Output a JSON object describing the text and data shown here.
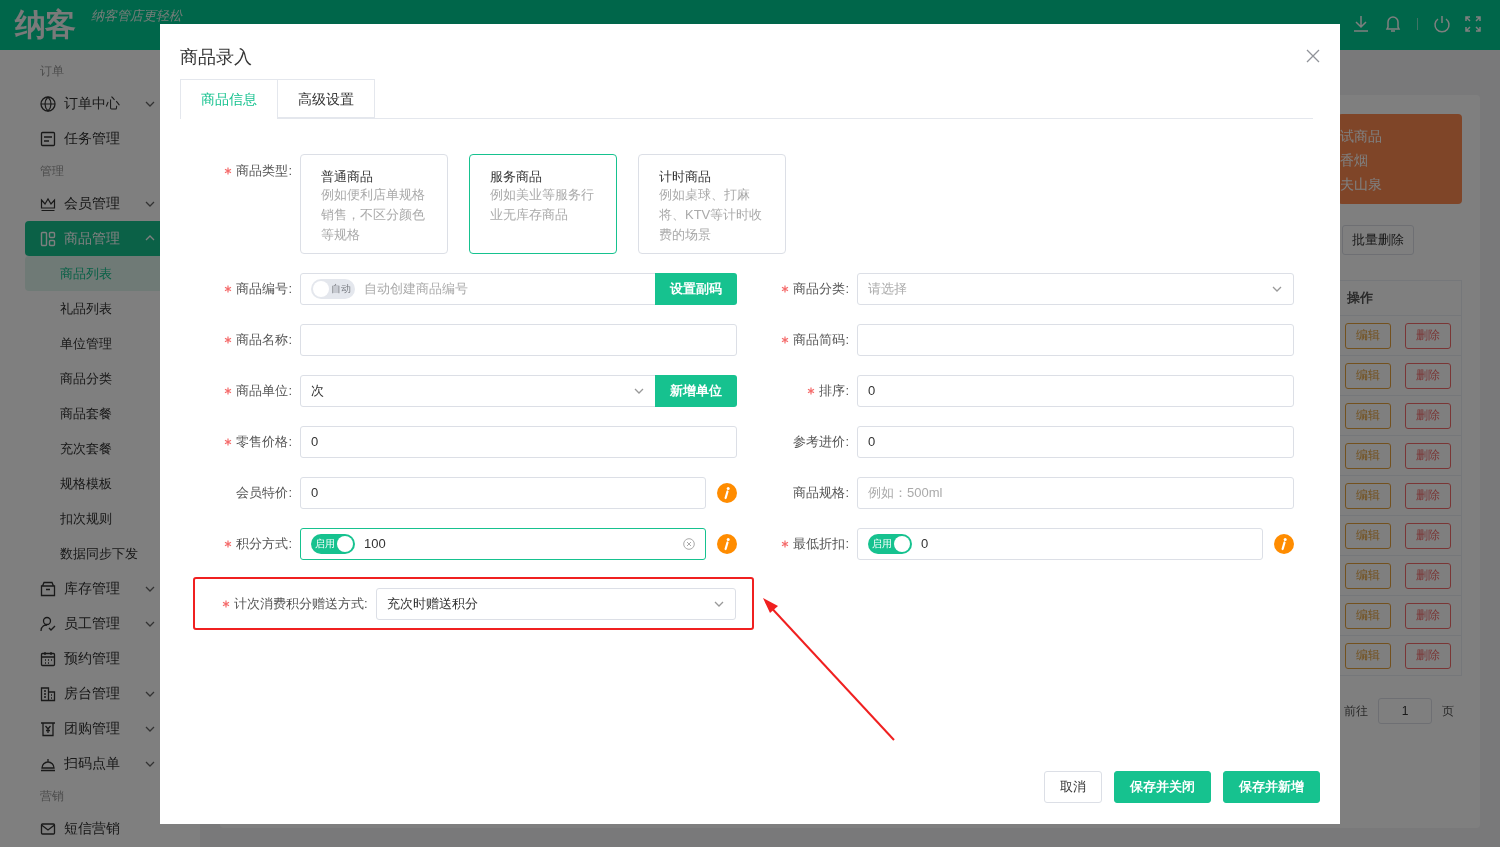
{
  "header": {
    "logo": "纳客",
    "slogan": "纳客管店更轻松"
  },
  "sidebar": {
    "sections": [
      {
        "title": "订单",
        "items": [
          {
            "label": "订单中心",
            "expanded": false,
            "selected": false
          },
          {
            "label": "任务管理",
            "selected": false
          }
        ]
      },
      {
        "title": "管理",
        "items": [
          {
            "label": "会员管理",
            "expanded": false,
            "selected": false
          },
          {
            "label": "商品管理",
            "expanded": true,
            "selected": true,
            "children": [
              {
                "label": "商品列表",
                "selected": true
              },
              {
                "label": "礼品列表",
                "selected": false
              },
              {
                "label": "单位管理",
                "selected": false
              },
              {
                "label": "商品分类",
                "selected": false
              },
              {
                "label": "商品套餐",
                "selected": false
              },
              {
                "label": "充次套餐",
                "selected": false
              },
              {
                "label": "规格模板",
                "selected": false
              },
              {
                "label": "扣次规则",
                "selected": false
              },
              {
                "label": "数据同步下发",
                "selected": false
              }
            ]
          },
          {
            "label": "库存管理",
            "expanded": false,
            "selected": false
          },
          {
            "label": "员工管理",
            "expanded": false,
            "selected": false
          },
          {
            "label": "预约管理",
            "selected": false
          },
          {
            "label": "房台管理",
            "expanded": false,
            "selected": false
          },
          {
            "label": "团购管理",
            "expanded": false,
            "selected": false
          },
          {
            "label": "扫码点单",
            "expanded": false,
            "selected": false
          }
        ]
      },
      {
        "title": "营销",
        "items": [
          {
            "label": "短信营销",
            "selected": false
          }
        ]
      }
    ]
  },
  "background": {
    "banner_lines": [
      "试商品",
      "香烟",
      "夫山泉"
    ],
    "batch_button": "批量删除",
    "table": {
      "column": "操作",
      "rows": [
        {
          "edit": "编辑",
          "delete": "删除"
        },
        {
          "edit": "编辑",
          "delete": "删除"
        },
        {
          "edit": "编辑",
          "delete": "删除"
        },
        {
          "edit": "编辑",
          "delete": "删除"
        },
        {
          "edit": "编辑",
          "delete": "删除"
        },
        {
          "edit": "编辑",
          "delete": "删除"
        },
        {
          "edit": "编辑",
          "delete": "删除"
        },
        {
          "edit": "编辑",
          "delete": "删除"
        },
        {
          "edit": "编辑",
          "delete": "删除"
        }
      ]
    },
    "pagination": {
      "goto": "前往",
      "page": "1",
      "suffix": "页"
    }
  },
  "dialog": {
    "title": "商品录入",
    "tabs": [
      {
        "label": "商品信息",
        "selected": true
      },
      {
        "label": "高级设置",
        "selected": false
      }
    ],
    "type_field": {
      "label": "商品类型:",
      "required": true,
      "options": [
        {
          "title": "普通商品",
          "description": "例如便利店单规格销售，不区分颜色等规格",
          "selected": false
        },
        {
          "title": "服务商品",
          "description": "例如美业等服务行业无库存商品",
          "selected": true
        },
        {
          "title": "计时商品",
          "description": "例如桌球、打麻将、KTV等计时收费的场景",
          "selected": false
        }
      ]
    },
    "rows": [
      {
        "left": {
          "label": "商品编号:",
          "required": true,
          "kind": "toggle-input",
          "toggle": {
            "label": "自动",
            "on": false
          },
          "placeholder": "自动创建商品编号",
          "button": "设置副码"
        },
        "right": {
          "label": "商品分类:",
          "required": true,
          "kind": "select",
          "placeholder": "请选择"
        }
      },
      {
        "left": {
          "label": "商品名称:",
          "required": true,
          "kind": "input"
        },
        "right": {
          "label": "商品简码:",
          "required": true,
          "kind": "input"
        }
      },
      {
        "left": {
          "label": "商品单位:",
          "required": true,
          "kind": "select",
          "value": "次",
          "button": "新增单位"
        },
        "right": {
          "label": "排序:",
          "required": true,
          "kind": "input",
          "value": "0"
        }
      },
      {
        "left": {
          "label": "零售价格:",
          "required": true,
          "kind": "input",
          "value": "0"
        },
        "right": {
          "label": "参考进价:",
          "kind": "input",
          "value": "0"
        }
      },
      {
        "left": {
          "label": "会员特价:",
          "kind": "input",
          "value": "0",
          "info": true
        },
        "right": {
          "label": "商品规格:",
          "kind": "input",
          "placeholder": "例如：500ml"
        }
      },
      {
        "left": {
          "label": "积分方式:",
          "required": true,
          "kind": "toggle-input",
          "toggle": {
            "label": "启用",
            "on": true
          },
          "value": "100",
          "info": true,
          "focused": true,
          "clearable": true
        },
        "right": {
          "label": "最低折扣:",
          "required": true,
          "kind": "toggle-input",
          "toggle": {
            "label": "启用",
            "on": true
          },
          "value": "0",
          "info": true
        }
      }
    ],
    "highlighted_field": {
      "label": "计次消费积分赠送方式:",
      "required": true,
      "kind": "select",
      "value": "充次时赠送积分",
      "pointer_arrow": true
    },
    "buttons": [
      {
        "label": "取消",
        "kind": "secondary"
      },
      {
        "label": "保存并关闭",
        "kind": "primary"
      },
      {
        "label": "保存并新增",
        "kind": "primary"
      }
    ]
  }
}
